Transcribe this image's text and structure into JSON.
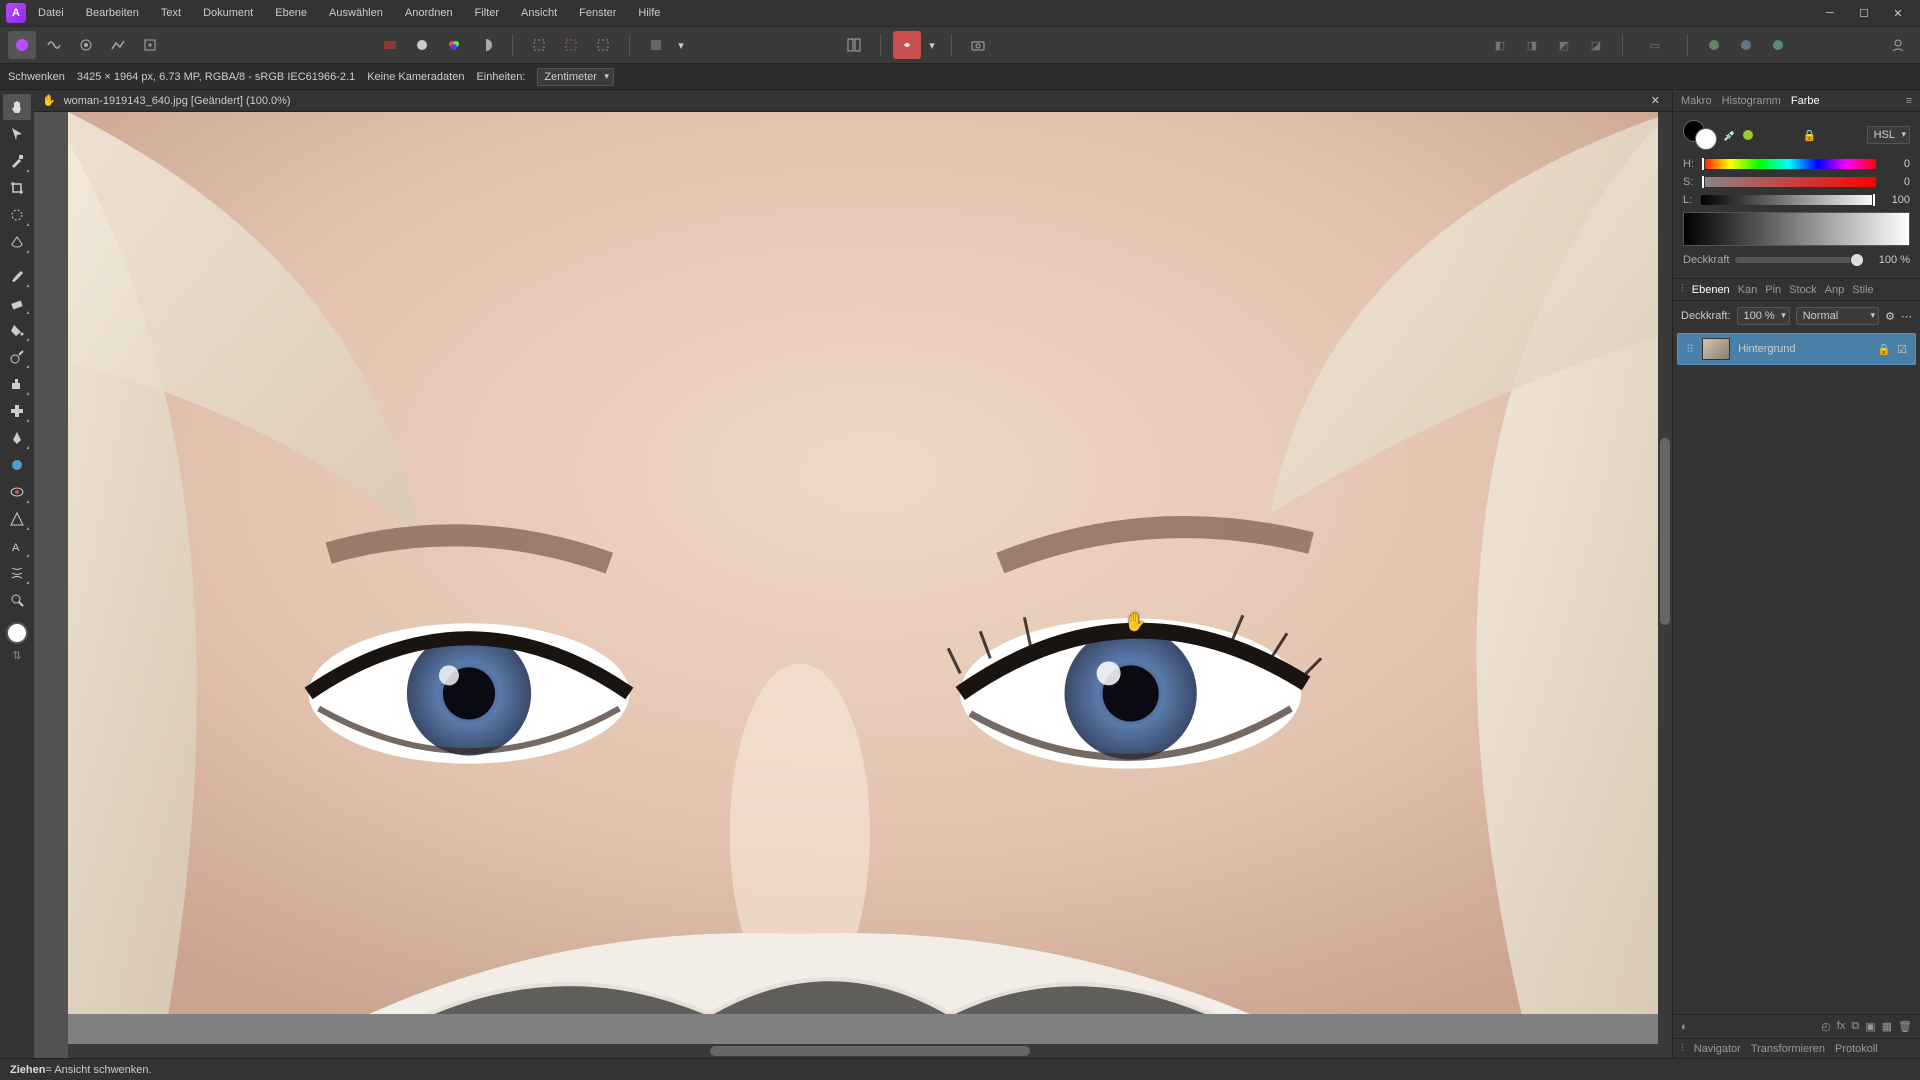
{
  "menu": {
    "items": [
      "Datei",
      "Bearbeiten",
      "Text",
      "Dokument",
      "Ebene",
      "Auswählen",
      "Anordnen",
      "Filter",
      "Ansicht",
      "Fenster",
      "Hilfe"
    ]
  },
  "context": {
    "tool": "Schwenken",
    "docinfo": "3425 × 1964 px, 6.73 MP, RGBA/8 - sRGB IEC61966-2.1",
    "camera": "Keine Kameradaten",
    "units_label": "Einheiten:",
    "units_value": "Zentimeter"
  },
  "document": {
    "tab": "woman-1919143_640.jpg [Geändert] (100.0%)"
  },
  "panels": {
    "top_tabs": [
      "Makro",
      "Histogramm",
      "Farbe"
    ],
    "active_top": "Farbe",
    "color": {
      "mode": "HSL",
      "h_label": "H:",
      "h_value": "0",
      "s_label": "S:",
      "s_value": "0",
      "l_label": "L:",
      "l_value": "100",
      "opacity_label": "Deckkraft",
      "opacity_value": "100 %"
    },
    "layer_tabs": [
      "Ebenen",
      "Kan",
      "Pin",
      "Stock",
      "Anp",
      "Stile"
    ],
    "active_layer_tab": "Ebenen",
    "layer_top": {
      "opacity_label": "Deckkraft:",
      "opacity_value": "100 %",
      "blend": "Normal"
    },
    "layers": [
      {
        "name": "Hintergrund"
      }
    ],
    "bottom_tabs": [
      "Navigator",
      "Transformieren",
      "Protokoll"
    ]
  },
  "status": {
    "key": "Ziehen",
    "text": " = Ansicht schwenken."
  }
}
